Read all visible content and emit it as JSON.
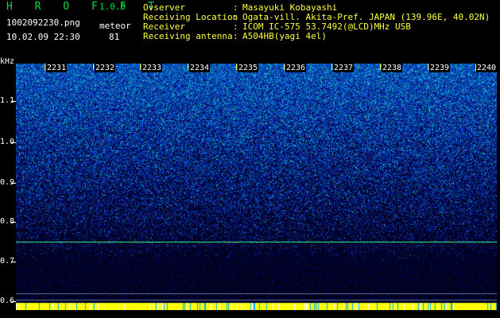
{
  "app": {
    "brand": "H R O F F T",
    "version": "1.0.0"
  },
  "file": {
    "name": "1002092230.png",
    "datetime": "10.02.09 22:30",
    "meteor_label": "meteor",
    "meteor_count": "81"
  },
  "header": {
    "rows": [
      {
        "label": "Ovserver",
        "value": "Masayuki Kobayashi"
      },
      {
        "label": "Receiving Location",
        "value": "Ogata-vill. Akita-Pref. JAPAN (139.96E, 40.02N)"
      },
      {
        "label": "Receiver",
        "value": "ICOM IC-575 53.7492(@LCD)MHz USB"
      },
      {
        "label": "Receiving antenna",
        "value": "A504HB(yagi 4el)"
      }
    ],
    "colon": ":"
  },
  "axis": {
    "unit": "kHz",
    "frequency_ticks": [
      "1.1",
      "1.0",
      "0.9",
      "0.8",
      "0.7",
      "0.6"
    ],
    "time_ticks": [
      "2231",
      "2232",
      "2233",
      "2234",
      "2235",
      "2236",
      "2237",
      "2238",
      "2239",
      "2240"
    ]
  },
  "colors": {
    "background": "#000000",
    "header_text": "#ffff40",
    "brand": "#00e040",
    "carrier_line": "#40ff80",
    "meteor_bar": "#ffff00"
  }
}
